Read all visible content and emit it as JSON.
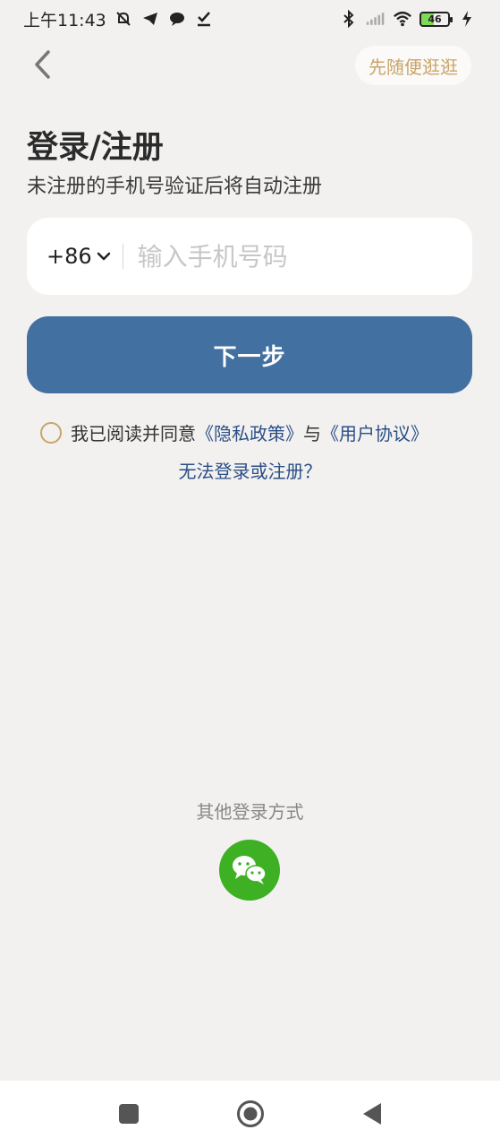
{
  "status_bar": {
    "time": "上午11:43",
    "battery_level": "46"
  },
  "header": {
    "browse_label": "先随便逛逛"
  },
  "login": {
    "title": "登录/注册",
    "subtitle": "未注册的手机号验证后将自动注册",
    "country_code": "+86",
    "phone_placeholder": "输入手机号码",
    "phone_value": "",
    "next_label": "下一步",
    "agreement_prefix": "我已阅读并同意",
    "privacy_link": "《隐私政策》",
    "agreement_joiner": "与",
    "user_agreement_link": "《用户协议》",
    "trouble_link": "无法登录或注册？"
  },
  "other_login": {
    "label": "其他登录方式",
    "icon": "wechat-icon"
  },
  "colors": {
    "primary": "#4270a0",
    "accent_gold": "#c9a46a",
    "link": "#2c4f86",
    "wechat": "#3db024",
    "background": "#f2f1f0"
  }
}
